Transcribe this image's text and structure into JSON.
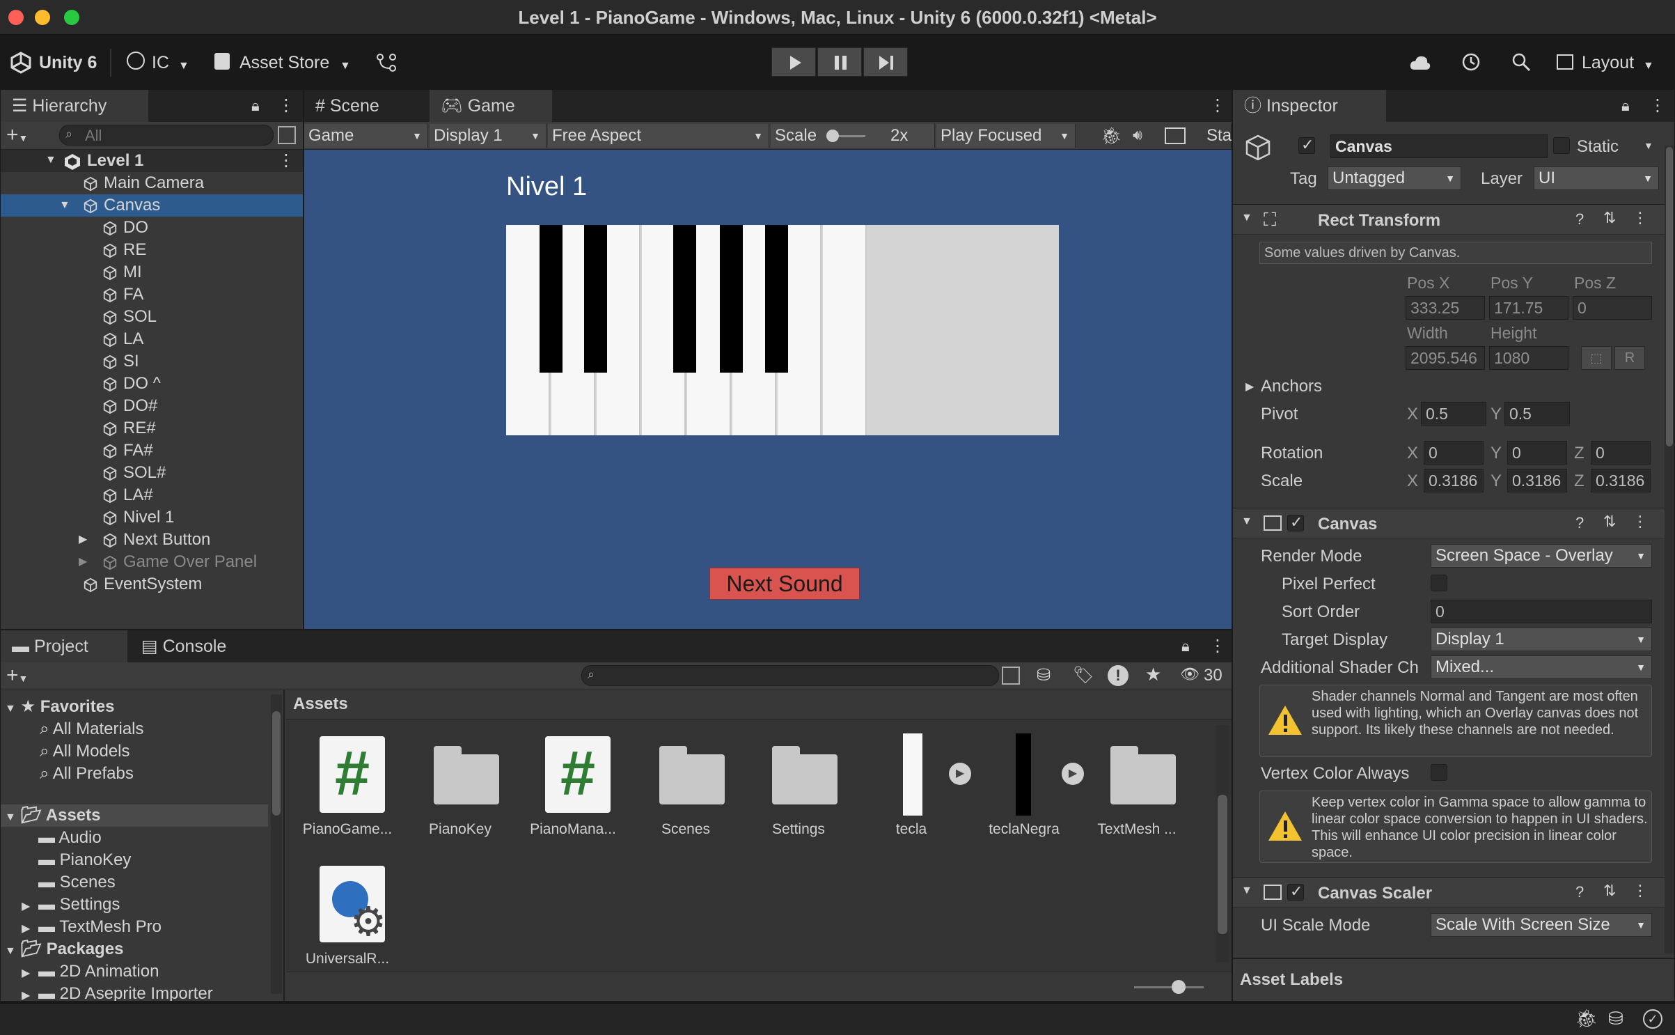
{
  "window": {
    "title": "Level 1 - PianoGame - Windows, Mac, Linux - Unity 6 (6000.0.32f1) <Metal>"
  },
  "toolbar": {
    "unity": "Unity 6",
    "account": "IC",
    "asset_store": "Asset Store",
    "layout": "Layout"
  },
  "hierarchy": {
    "tab": "Hierarchy",
    "search_placeholder": "All",
    "scene": "Level 1",
    "items": [
      "Main Camera",
      "Canvas",
      "DO",
      "RE",
      "MI",
      "FA",
      "SOL",
      "LA",
      "SI",
      "DO ^",
      "DO#",
      "RE#",
      "FA#",
      "SOL#",
      "LA#",
      "Nivel 1",
      "Next Button",
      "Game Over Panel",
      "EventSystem"
    ]
  },
  "scene_view": {
    "tab_scene": "Scene",
    "tab_game": "Game",
    "game_dd": "Game",
    "display_dd": "Display 1",
    "aspect_dd": "Free Aspect",
    "scale_label": "Scale",
    "scale_value": "2x",
    "play_mode": "Play Focused",
    "stats": "Sta"
  },
  "game": {
    "level_title": "Nivel 1",
    "next_sound": "Next Sound",
    "bg": "#355382",
    "button_color": "#d9534f"
  },
  "inspector": {
    "tab": "Inspector",
    "object_name": "Canvas",
    "static": "Static",
    "tag_label": "Tag",
    "tag": "Untagged",
    "layer_label": "Layer",
    "layer": "UI",
    "rect": {
      "title": "Rect Transform",
      "driven": "Some values driven by Canvas.",
      "posx_l": "Pos X",
      "posy_l": "Pos Y",
      "posz_l": "Pos Z",
      "posx": "333.25",
      "posy": "171.75",
      "posz": "0",
      "width_l": "Width",
      "height_l": "Height",
      "width": "2095.546",
      "height": "1080",
      "r": "R",
      "anchors": "Anchors",
      "pivot": "Pivot",
      "pivot_x": "0.5",
      "pivot_y": "0.5",
      "rotation": "Rotation",
      "rot_x": "0",
      "rot_y": "0",
      "rot_z": "0",
      "scale": "Scale",
      "scale_x": "0.3186",
      "scale_y": "0.3186",
      "scale_z": "0.3186",
      "x": "X",
      "y": "Y",
      "z": "Z"
    },
    "canvas": {
      "title": "Canvas",
      "render_mode_l": "Render Mode",
      "render_mode": "Screen Space - Overlay",
      "pixel_perfect": "Pixel Perfect",
      "sort_order_l": "Sort Order",
      "sort_order": "0",
      "target_display_l": "Target Display",
      "target_display": "Display 1",
      "shader_l": "Additional Shader Ch",
      "shader": "Mixed...",
      "warn1": "Shader channels Normal and Tangent are most often used with lighting, which an Overlay canvas does not support. Its likely these channels are not needed.",
      "vertex_l": "Vertex Color Always",
      "warn2": "Keep vertex color in Gamma space to allow gamma to linear color space conversion to happen in UI shaders. This will enhance UI color precision in linear color space."
    },
    "scaler": {
      "title": "Canvas Scaler",
      "mode_l": "UI Scale Mode",
      "mode": "Scale With Screen Size"
    },
    "asset_labels": "Asset Labels"
  },
  "project": {
    "tab_project": "Project",
    "tab_console": "Console",
    "count": "30",
    "breadcrumb": "Assets",
    "favorites": "Favorites",
    "fav_items": [
      "All Materials",
      "All Models",
      "All Prefabs"
    ],
    "assets_root": "Assets",
    "asset_folders": [
      "Audio",
      "PianoKey",
      "Scenes",
      "Settings",
      "TextMesh Pro"
    ],
    "packages": "Packages",
    "package_items": [
      "2D Animation",
      "2D Aseprite Importer"
    ],
    "assets": [
      "PianoGame...",
      "PianoKey",
      "PianoMana...",
      "Scenes",
      "Settings",
      "tecla",
      "teclaNegra",
      "TextMesh ...",
      "UniversalR..."
    ]
  }
}
